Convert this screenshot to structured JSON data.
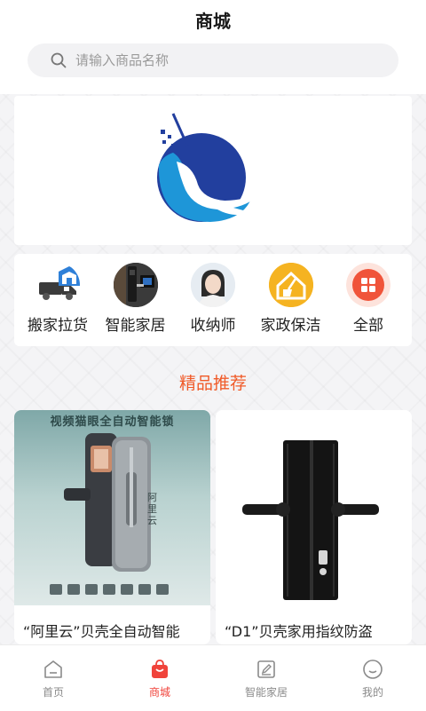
{
  "header": {
    "title": "商城"
  },
  "search": {
    "placeholder": "请输入商品名称"
  },
  "categories": [
    {
      "label": "搬家拉货",
      "icon": "moving-truck-icon"
    },
    {
      "label": "智能家居",
      "icon": "smart-home-photo"
    },
    {
      "label": "收纳师",
      "icon": "organizer-avatar"
    },
    {
      "label": "家政保洁",
      "icon": "cleaning-house-icon"
    },
    {
      "label": "全部",
      "icon": "all-categories-icon"
    }
  ],
  "section": {
    "title": "精品推荐"
  },
  "products": [
    {
      "name": "“阿里云”贝壳全自动智能",
      "image_caption": "视频猫眼全自动智能锁",
      "side_text": "阿里云"
    },
    {
      "name": "“D1”贝壳家用指纹防盗"
    }
  ],
  "tabbar": {
    "items": [
      {
        "label": "首页",
        "icon": "home-icon",
        "active": false
      },
      {
        "label": "商城",
        "icon": "shopping-bag-icon",
        "active": true
      },
      {
        "label": "智能家居",
        "icon": "edit-icon",
        "active": false
      },
      {
        "label": "我的",
        "icon": "user-icon",
        "active": false
      }
    ]
  },
  "colors": {
    "accent": "#f0433b",
    "section_title": "#f05a28",
    "logo_blue": "#1e96d8",
    "logo_navy": "#223f9e"
  }
}
